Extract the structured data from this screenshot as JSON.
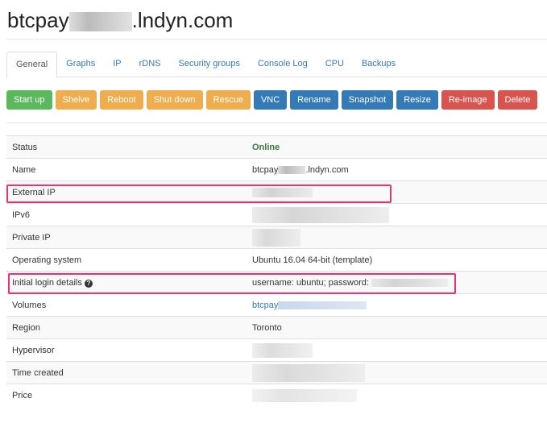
{
  "header": {
    "title_prefix": "btcpay",
    "title_suffix": ".lndyn.com"
  },
  "tabs": [
    {
      "label": "General",
      "active": true
    },
    {
      "label": "Graphs"
    },
    {
      "label": "IP"
    },
    {
      "label": "rDNS"
    },
    {
      "label": "Security groups"
    },
    {
      "label": "Console Log"
    },
    {
      "label": "CPU"
    },
    {
      "label": "Backups"
    }
  ],
  "actions": [
    {
      "label": "Start up",
      "color": "#5cb85c"
    },
    {
      "label": "Shelve",
      "color": "#f0ad4e"
    },
    {
      "label": "Reboot",
      "color": "#f0ad4e"
    },
    {
      "label": "Shut down",
      "color": "#f0ad4e"
    },
    {
      "label": "Rescue",
      "color": "#f0ad4e"
    },
    {
      "label": "VNC",
      "color": "#337ab7"
    },
    {
      "label": "Rename",
      "color": "#337ab7"
    },
    {
      "label": "Snapshot",
      "color": "#337ab7"
    },
    {
      "label": "Resize",
      "color": "#337ab7"
    },
    {
      "label": "Re-image",
      "color": "#d9534f"
    },
    {
      "label": "Delete",
      "color": "#d9534f"
    }
  ],
  "details": {
    "status": {
      "label": "Status",
      "value": "Online",
      "color": "#3c763d"
    },
    "name": {
      "label": "Name",
      "value_prefix": "btcpay",
      "value_suffix": ".lndyn.com"
    },
    "external_ip": {
      "label": "External IP"
    },
    "ipv6": {
      "label": "IPv6"
    },
    "private_ip": {
      "label": "Private IP"
    },
    "os": {
      "label": "Operating system",
      "value": "Ubuntu 16.04 64-bit (template)"
    },
    "login": {
      "label": "Initial login details",
      "help_icon": "question-circle-icon",
      "value": "username: ubuntu; password:"
    },
    "volumes": {
      "label": "Volumes",
      "value_prefix": "btcpay"
    },
    "region": {
      "label": "Region",
      "value": "Toronto"
    },
    "hypervisor": {
      "label": "Hypervisor"
    },
    "time_created": {
      "label": "Time created"
    },
    "price": {
      "label": "Price"
    }
  },
  "highlight_color": "#e8336b"
}
